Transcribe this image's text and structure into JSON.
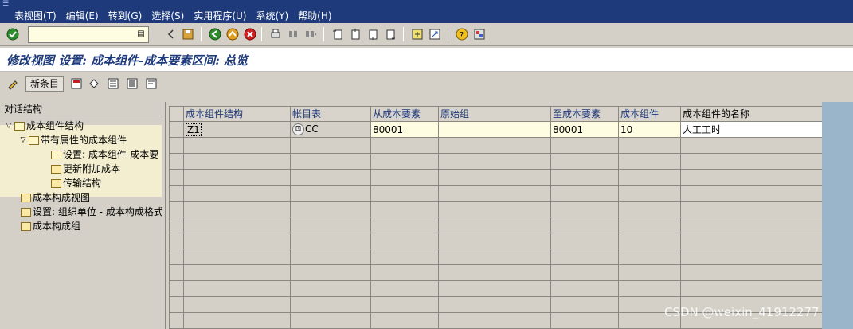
{
  "menu": {
    "items": [
      "表视图(T)",
      "编辑(E)",
      "转到(G)",
      "选择(S)",
      "实用程序(U)",
      "系统(Y)",
      "帮助(H)"
    ]
  },
  "toolbar": {
    "command_field_value": "",
    "icons": [
      "enter-icon",
      "command-dropdown-icon",
      "back-arrow-icon",
      "save-icon",
      "back-icon",
      "exit-icon",
      "cancel-icon",
      "print-icon",
      "find-icon",
      "find-next-icon",
      "first-page-icon",
      "previous-page-icon",
      "next-page-icon",
      "last-page-icon",
      "create-session-icon",
      "shortcut-icon",
      "help-icon",
      "customize-layout-icon"
    ]
  },
  "title": "修改视图 设置: 成本组件-成本要素区间: 总览",
  "app_toolbar": {
    "new_entries_label": "新条目",
    "icons": [
      "display-change-icon",
      "copy-icon",
      "undo-icon",
      "select-all-icon",
      "select-block-icon",
      "deselect-all-icon"
    ]
  },
  "tree": {
    "header": "对话结构",
    "nodes": [
      {
        "label": "成本组件结构"
      },
      {
        "label": "带有属性的成本组件"
      },
      {
        "label": "设置: 成本组件-成本要"
      },
      {
        "label": "更新附加成本"
      },
      {
        "label": "传输结构"
      },
      {
        "label": "成本构成视图"
      },
      {
        "label": "设置: 组织单位 - 成本构成格式"
      },
      {
        "label": "成本构成组"
      }
    ]
  },
  "table": {
    "columns": [
      "成本组件结构",
      "帐目表",
      "从成本要素",
      "原始组",
      "至成本要素",
      "成本组件",
      "成本组件的名称"
    ],
    "rows": [
      {
        "structure": "Z1",
        "chart": "CC",
        "from": "80001",
        "origin": "",
        "to": "80001",
        "component": "10",
        "name": "人工工时"
      }
    ]
  },
  "watermark": "CSDN @weixin_41912277"
}
